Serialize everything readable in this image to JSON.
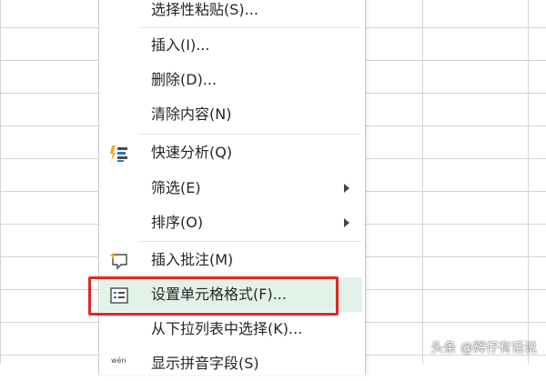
{
  "menu": {
    "items": [
      {
        "label": "选择性粘贴(S)...",
        "has_submenu": false
      },
      {
        "label": "插入(I)...",
        "has_submenu": false
      },
      {
        "label": "删除(D)...",
        "has_submenu": false
      },
      {
        "label": "清除内容(N)",
        "has_submenu": false
      },
      {
        "label": "快速分析(Q)",
        "has_submenu": false,
        "icon": "quick-analysis-icon"
      },
      {
        "label": "筛选(E)",
        "has_submenu": true
      },
      {
        "label": "排序(O)",
        "has_submenu": true
      },
      {
        "label": "插入批注(M)",
        "has_submenu": false,
        "icon": "new-comment-icon"
      },
      {
        "label": "设置单元格格式(F)...",
        "has_submenu": false,
        "icon": "format-cells-icon",
        "highlighted": true
      },
      {
        "label": "从下拉列表中选择(K)...",
        "has_submenu": false
      },
      {
        "label": "显示拼音字段(S)",
        "has_submenu": false,
        "icon": "phonetic-icon"
      }
    ]
  },
  "highlight_color": "#e0262a",
  "watermark": "头条 @辉仔有话说"
}
